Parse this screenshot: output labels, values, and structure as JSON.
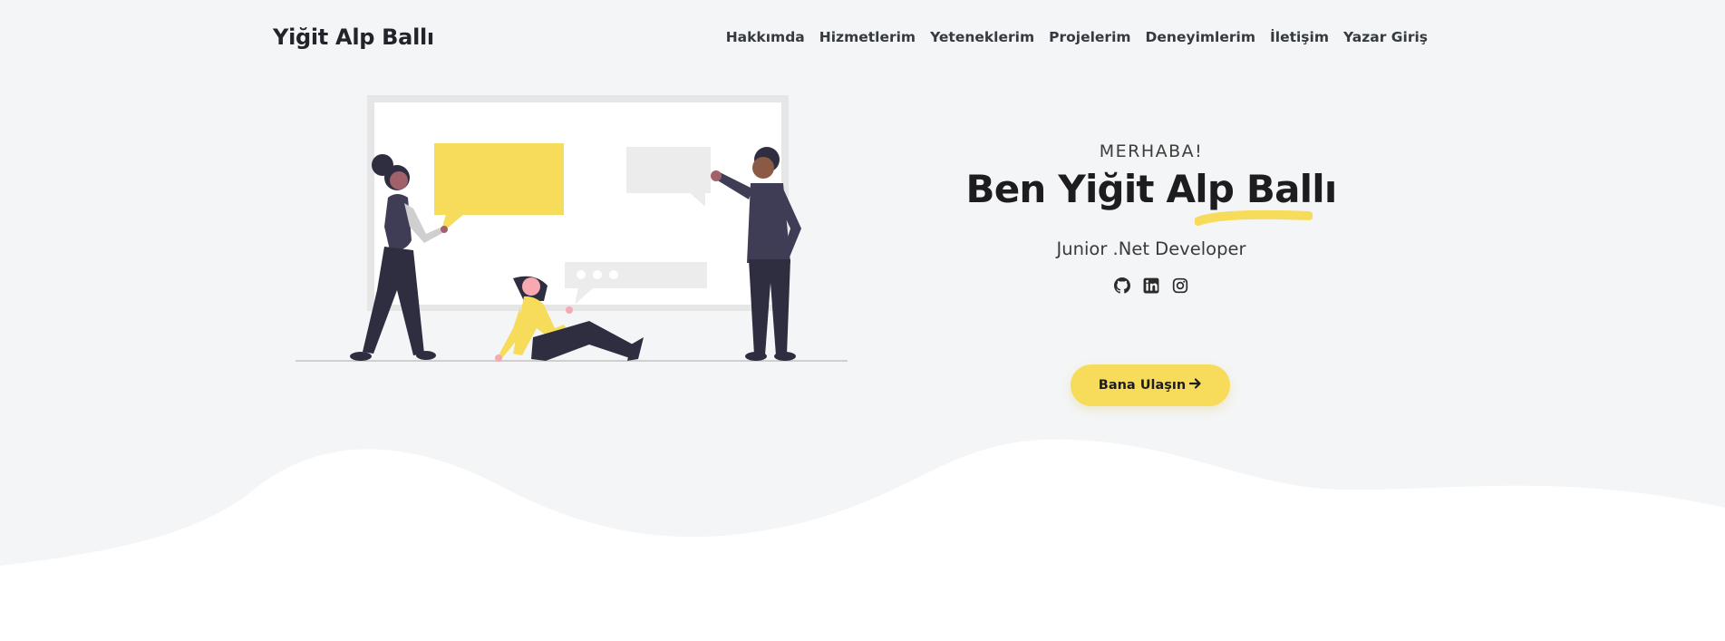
{
  "nav": {
    "brand": "Yiğit Alp Ballı",
    "links": [
      "Hakkımda",
      "Hizmetlerim",
      "Yeteneklerim",
      "Projelerim",
      "Deneyimlerim",
      "İletişim",
      "Yazar Giriş"
    ]
  },
  "hero": {
    "greeting": "MERHABA!",
    "title": "Ben Yiğit Alp Ballı",
    "subtitle": "Junior .Net Developer",
    "cta_label": "Bana Ulaşın",
    "cta_icon": "arrow-right-icon",
    "socials": [
      "github-icon",
      "linkedin-icon",
      "instagram-icon"
    ]
  },
  "colors": {
    "accent": "#f7dc5b",
    "background": "#f4f5f6",
    "dark": "#2f2e41"
  }
}
